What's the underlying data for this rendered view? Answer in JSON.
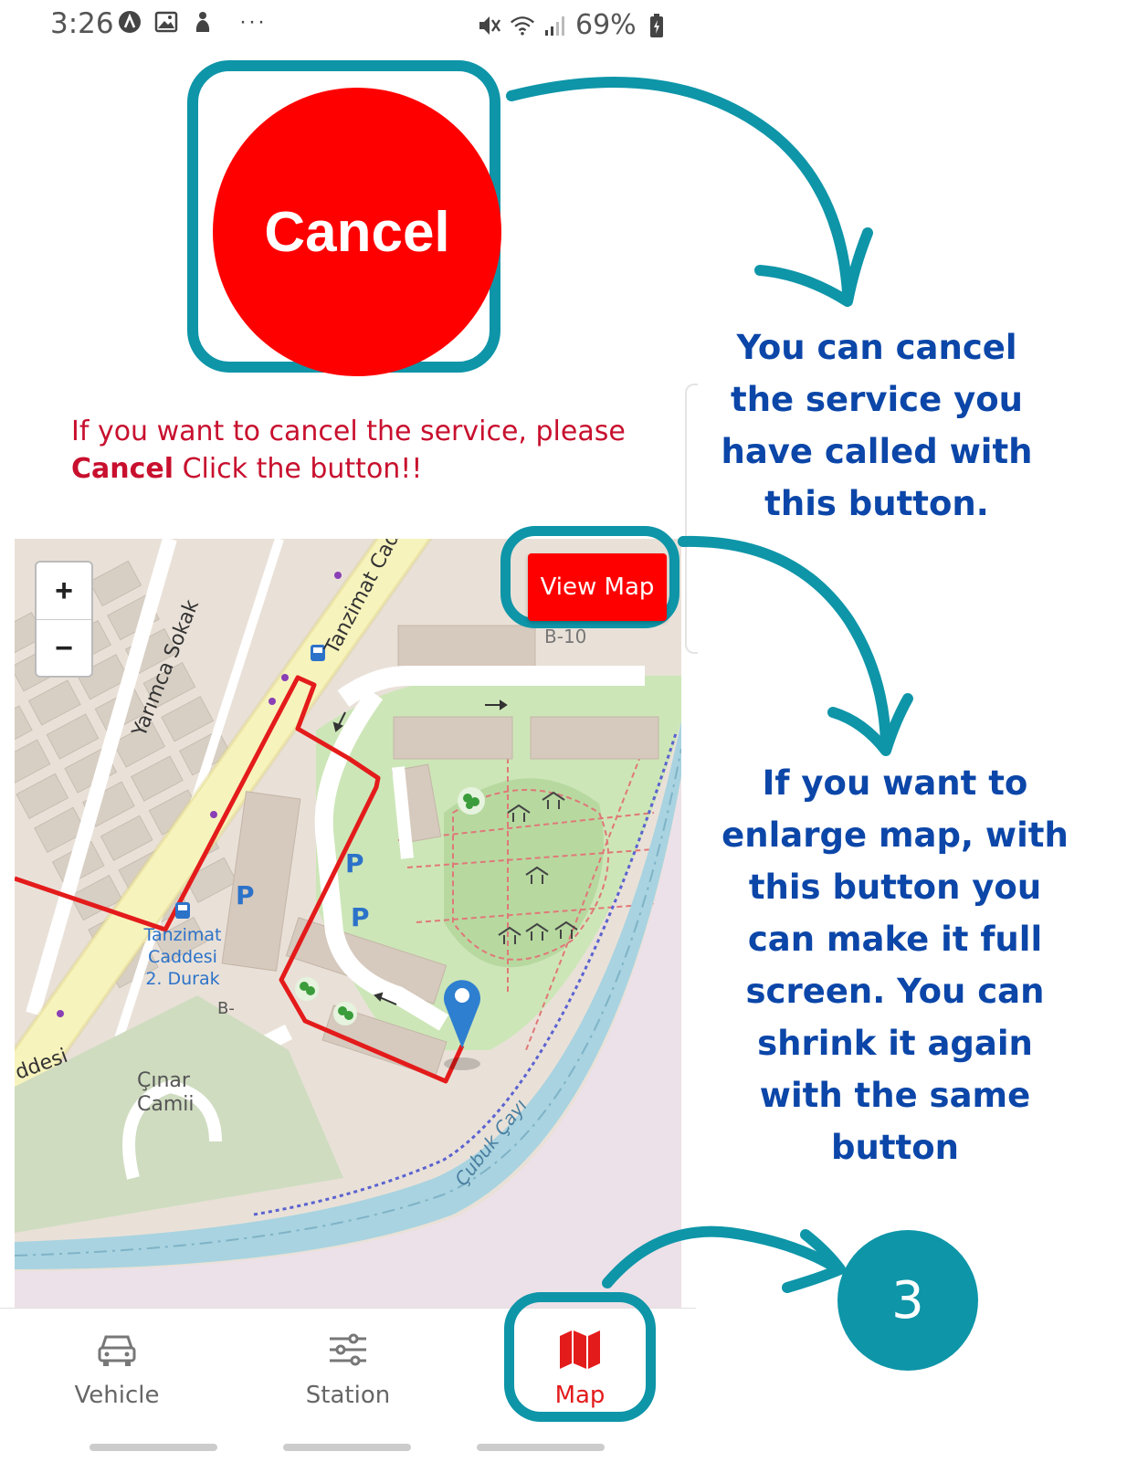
{
  "status_bar": {
    "time": "3:26",
    "dots": "···",
    "battery": "69%",
    "icons_left": [
      "app-a-icon",
      "gallery-icon",
      "notification-icon"
    ],
    "icons_right": [
      "mute-icon",
      "wifi-icon",
      "signal-icon",
      "battery-charging-icon"
    ]
  },
  "cancel": {
    "button_label": "Cancel",
    "instruction_line1": "If you want to cancel the service, please",
    "instruction_bold": "Cancel",
    "instruction_rest": " Click the button!!"
  },
  "annotations": {
    "cancel_note": "You can cancel the service you have called with this button.",
    "map_note": "If you want to enlarge map, with this button you can make it full screen. You can shrink it again with the same button"
  },
  "map": {
    "zoom_in": "+",
    "zoom_out": "−",
    "view_map_label": "View Map",
    "labels": {
      "tanzimat_cad": "Tanzimat Cad",
      "yarimca_sokak": "Yarımca Sokak",
      "stop_line1": "Tanzimat",
      "stop_line2": "Caddesi",
      "stop_line3": "2. Durak",
      "cinar_line1": "Çınar",
      "cinar_line2": "Camii",
      "cubuk_cayi": "Çubuk Çayı",
      "caddesi_fragment": "ddesi",
      "b10": "B-10",
      "b_label": "B-",
      "parking": "P"
    }
  },
  "bottom_nav": {
    "items": [
      {
        "label": "Vehicle",
        "icon": "car-icon"
      },
      {
        "label": "Station",
        "icon": "sliders-icon"
      },
      {
        "label": "Map",
        "icon": "map-icon"
      }
    ],
    "active": "Map"
  },
  "step": {
    "number": "3"
  },
  "colors": {
    "accent_teal": "#0e95a8",
    "cancel_red": "#ff0000",
    "annotation_blue": "#0b46a8",
    "instruction_red": "#c8102e"
  }
}
